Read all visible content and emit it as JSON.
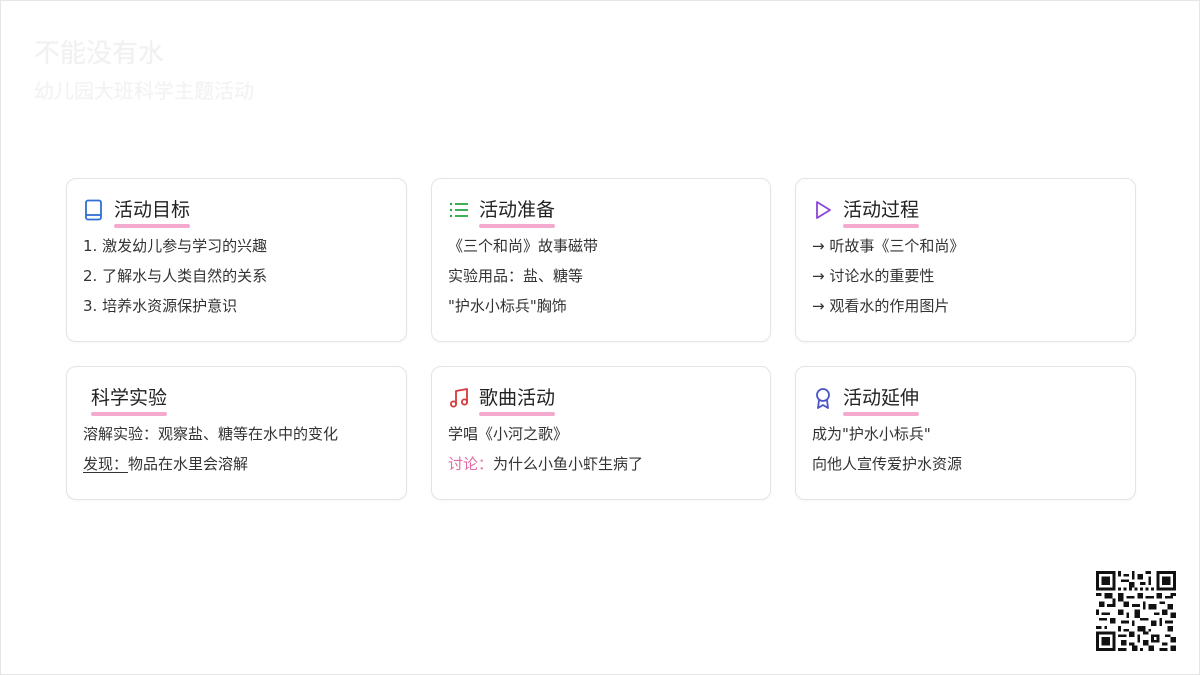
{
  "header": {
    "title": "不能没有水",
    "subtitle": "幼儿园大班科学主题活动"
  },
  "cards": [
    {
      "title": "活动目标",
      "icon": "book-icon",
      "icon_color": "#2f6fd6",
      "lines": [
        "1. 激发幼儿参与学习的兴趣",
        "2. 了解水与人类自然的关系",
        "3. 培养水资源保护意识"
      ]
    },
    {
      "title": "活动准备",
      "icon": "list-icon",
      "icon_color": "#28a745",
      "lines": [
        "《三个和尚》故事磁带",
        "实验用品：盐、糖等",
        "\"护水小标兵\"胸饰"
      ]
    },
    {
      "title": "活动过程",
      "icon": "play-icon",
      "icon_color": "#8e44d6",
      "lines": [
        "→ 听故事《三个和尚》",
        "→ 讨论水的重要性",
        "→ 观看水的作用图片"
      ]
    },
    {
      "title": "科学实验",
      "icon": "",
      "lines": [
        "溶解实验：观察盐、糖等在水中的变化"
      ],
      "finding_label": "发现：",
      "finding_text": "物品在水里会溶解"
    },
    {
      "title": "歌曲活动",
      "icon": "music-icon",
      "icon_color": "#d63a3a",
      "lines": [
        "学唱《小河之歌》"
      ],
      "discuss_label": "讨论：",
      "discuss_text": "为什么小鱼小虾生病了"
    },
    {
      "title": "活动延伸",
      "icon": "award-icon",
      "icon_color": "#4a55c9",
      "lines": [
        "成为\"护水小标兵\"",
        "向他人宣传爱护水资源"
      ]
    }
  ],
  "colors": {
    "accent_underline": "#f4a9cf",
    "card_border": "#e4e4e4",
    "text": "#333333"
  }
}
